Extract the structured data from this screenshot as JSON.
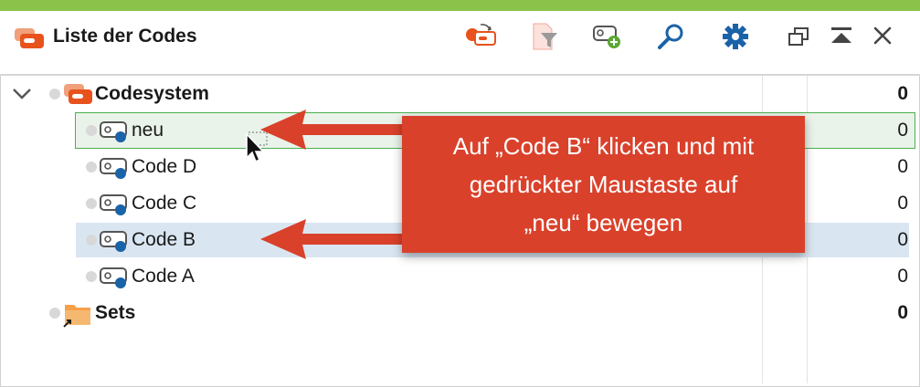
{
  "window": {
    "title": "Liste der Codes",
    "accent_color": "#8bc34a"
  },
  "toolbar": {
    "icons": [
      "code-reset-icon",
      "filter-document-icon",
      "new-code-icon",
      "search-icon",
      "settings-gear-icon",
      "undock-window-icon",
      "collapse-up-icon",
      "close-icon"
    ]
  },
  "tree": {
    "rows": [
      {
        "label": "Codesystem",
        "count": "0",
        "kind": "root"
      },
      {
        "label": "neu",
        "count": "0",
        "kind": "code"
      },
      {
        "label": "Code D",
        "count": "0",
        "kind": "code"
      },
      {
        "label": "Code C",
        "count": "0",
        "kind": "code"
      },
      {
        "label": "Code B",
        "count": "0",
        "kind": "code"
      },
      {
        "label": "Code A",
        "count": "0",
        "kind": "code"
      },
      {
        "label": "Sets",
        "count": "0",
        "kind": "sets"
      }
    ]
  },
  "callout": {
    "lines": [
      "Auf „Code B“ klicken und mit",
      "gedrückter Maustaste auf",
      "„neu“ bewegen"
    ],
    "color": "#d9412b"
  }
}
